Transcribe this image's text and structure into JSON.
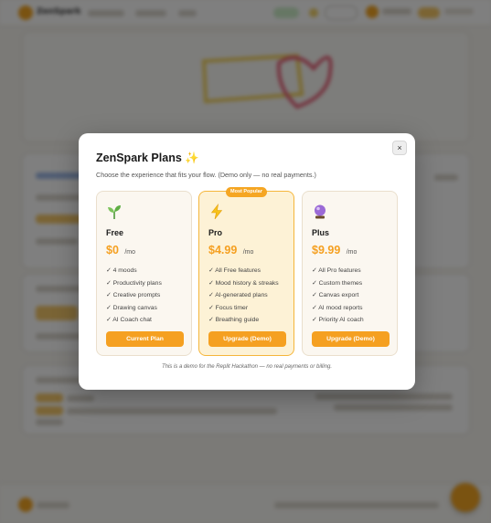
{
  "app": {
    "name": "ZenSpark"
  },
  "modal": {
    "title": "ZenSpark Plans ✨",
    "subtitle": "Choose the experience that fits your flow. (Demo only — no real payments.)",
    "close_label": "×",
    "note": "This is a demo for the Replit Hackathon — no real payments or billing.",
    "plans": [
      {
        "name": "Free",
        "icon": "seedling-icon",
        "price": "$0",
        "per": "/mo",
        "features": [
          "✓ 4 moods",
          "✓ Productivity plans",
          "✓ Creative prompts",
          "✓ Drawing canvas",
          "✓ AI Coach chat"
        ],
        "button": "Current Plan"
      },
      {
        "name": "Pro",
        "icon": "lightning-icon",
        "badge": "Most Popular",
        "price": "$4.99",
        "per": "/mo",
        "features": [
          "✓ All Free features",
          "✓ Mood history & streaks",
          "✓ AI-generated plans",
          "✓ Focus timer",
          "✓ Breathing guide"
        ],
        "button": "Upgrade (Demo)"
      },
      {
        "name": "Plus",
        "icon": "crystal-ball-icon",
        "price": "$9.99",
        "per": "/mo",
        "features": [
          "✓ All Pro features",
          "✓ Custom themes",
          "✓ Canvas export",
          "✓ AI mood reports",
          "✓ Priority AI coach"
        ],
        "button": "Upgrade (Demo)"
      }
    ]
  },
  "colors": {
    "accent": "#f5a021",
    "pro_background": "#fdf2d6",
    "overlay": "rgba(0,0,0,0.5)"
  }
}
